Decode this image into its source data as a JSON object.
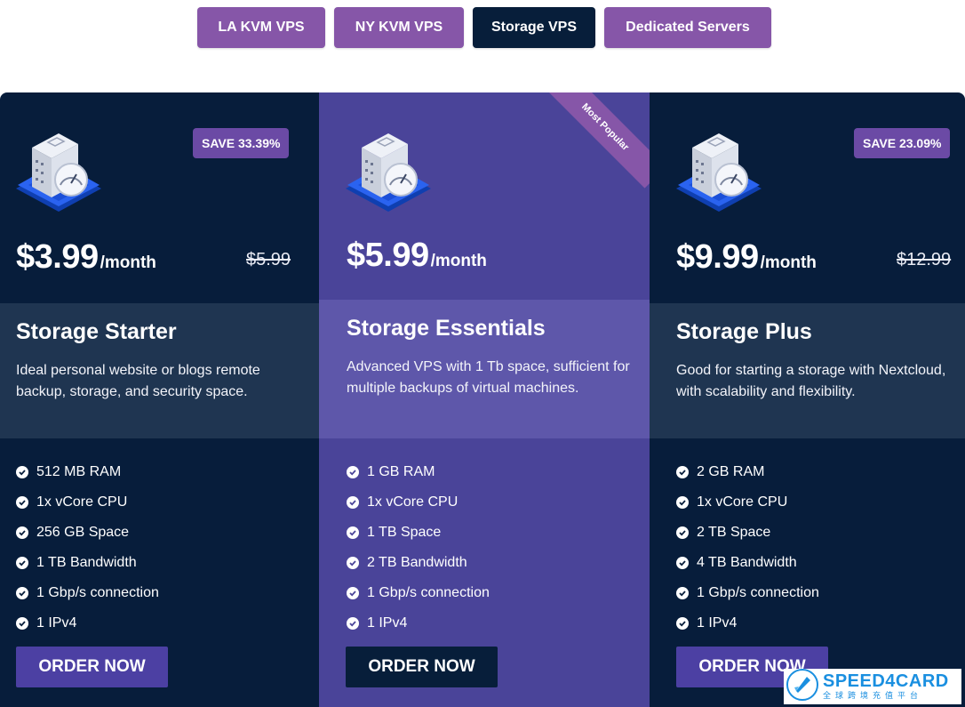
{
  "tabs": [
    {
      "label": "LA KVM VPS",
      "active": false
    },
    {
      "label": "NY KVM VPS",
      "active": false
    },
    {
      "label": "Storage VPS",
      "active": true
    },
    {
      "label": "Dedicated Servers",
      "active": false
    }
  ],
  "plans": [
    {
      "save": "SAVE 33.39%",
      "price": "$3.99",
      "period": "/month",
      "old_price": "$5.99",
      "name": "Storage Starter",
      "description": "Ideal personal website or blogs remote backup, storage, and security space.",
      "features": [
        "512 MB RAM",
        "1x vCore CPU",
        "256 GB Space",
        "1 TB Bandwidth",
        "1 Gbp/s connection",
        "1 IPv4"
      ],
      "button": "ORDER NOW"
    },
    {
      "ribbon": "Most Popular",
      "price": "$5.99",
      "period": "/month",
      "name": "Storage Essentials",
      "description": "Advanced VPS with 1 Tb space, sufficient for multiple backups of virtual machines.",
      "features": [
        "1 GB RAM",
        "1x vCore CPU",
        "1 TB Space",
        "2 TB Bandwidth",
        "1 Gbp/s connection",
        "1 IPv4"
      ],
      "button": "ORDER NOW"
    },
    {
      "save": "SAVE 23.09%",
      "price": "$9.99",
      "period": "/month",
      "old_price": "$12.99",
      "name": "Storage Plus",
      "description": "Good for starting a storage with Nextcloud, with scalability and flexibility.",
      "features": [
        "2 GB RAM",
        "1x vCore CPU",
        "2 TB Space",
        "4 TB Bandwidth",
        "1 Gbp/s connection",
        "1 IPv4"
      ],
      "button": "ORDER NOW"
    }
  ],
  "watermark": {
    "brand": "SPEED4CARD",
    "subtitle": "全球跨境充值平台"
  },
  "colors": {
    "navy": "#071d3b",
    "purple": "#8656a8",
    "featured": "#4a4499",
    "badge": "#6b4aa5"
  },
  "icons": {
    "server": "server-gauge-icon",
    "check": "check-circle-icon",
    "logo": "rocket-icon"
  }
}
